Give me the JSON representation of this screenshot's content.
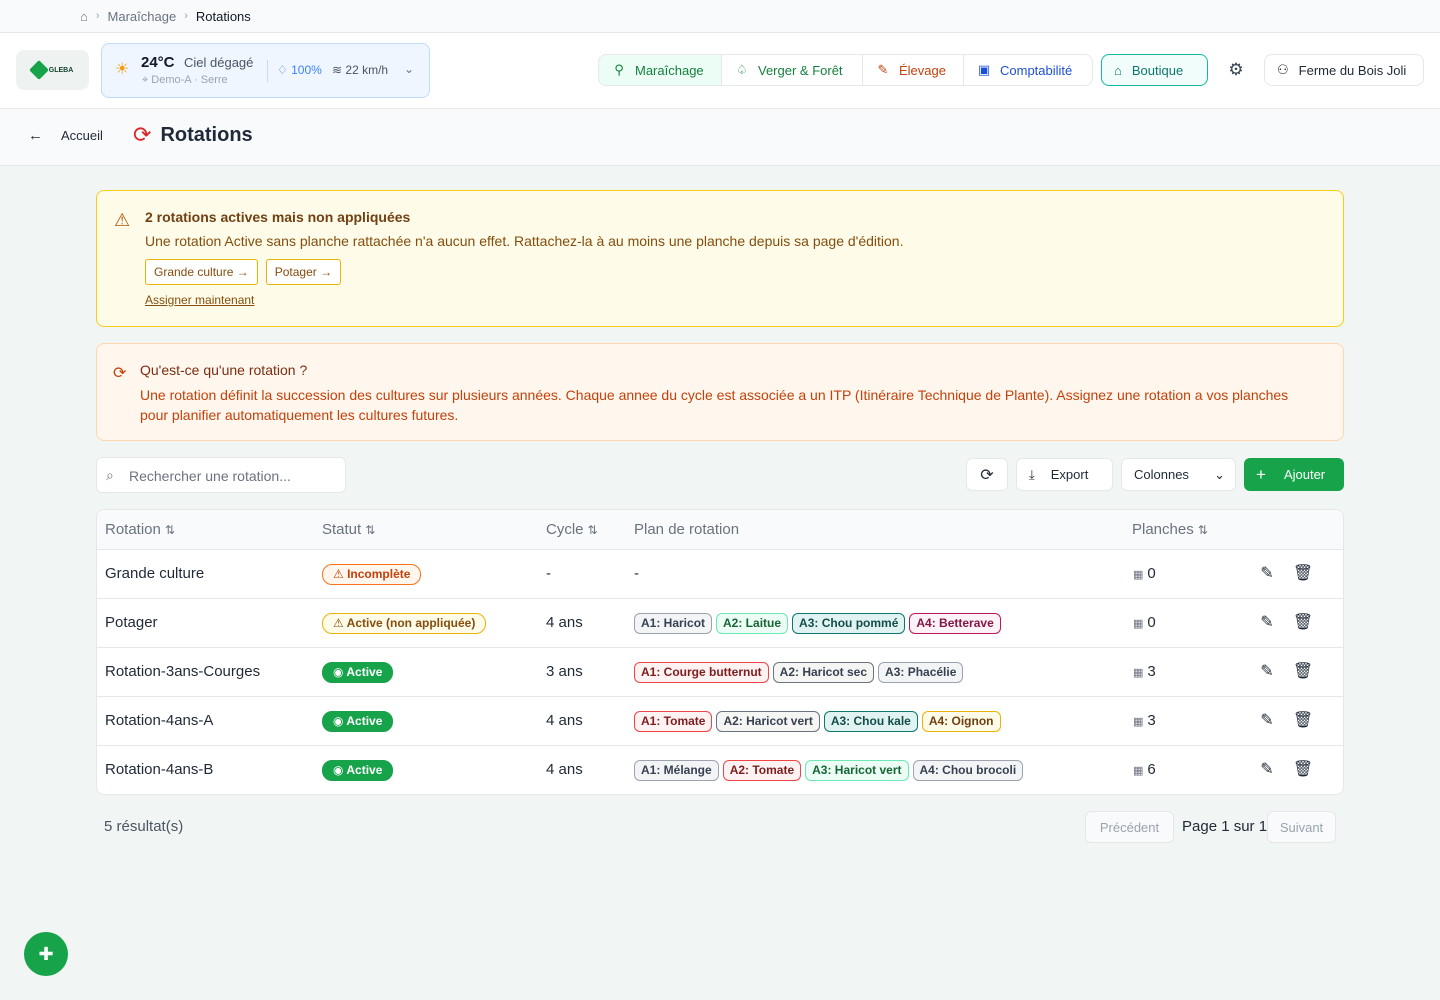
{
  "breadcrumb": {
    "items": [
      "Maraîchage",
      "Rotations"
    ]
  },
  "header": {
    "logo_text": "GLEBA",
    "weather": {
      "temperature": "24°C",
      "condition": "Ciel dégagé",
      "location": "Demo-A · Serre",
      "humidity": "100%",
      "wind": "22 km/h"
    },
    "modules": [
      {
        "label": "Maraîchage",
        "icon": "sprout-icon"
      },
      {
        "label": "Verger & Forêt",
        "icon": "tree-icon"
      },
      {
        "label": "Élevage",
        "icon": "carrot-icon"
      },
      {
        "label": "Comptabilité",
        "icon": "wallet-icon"
      }
    ],
    "shop_label": "Boutique",
    "farm_name": "Ferme du Bois Joli"
  },
  "page": {
    "back_label": "Accueil",
    "title": "Rotations"
  },
  "warning": {
    "title": "2 rotations actives mais non appliquées",
    "text": "Une rotation Active sans planche rattachée n'a aucun effet. Rattachez-la à au moins une planche depuis sa page d'édition.",
    "chips": [
      "Grande culture →",
      "Potager →"
    ],
    "link": "Assigner maintenant"
  },
  "info": {
    "title": "Qu'est-ce qu'une rotation ?",
    "text": "Une rotation définit la succession des cultures sur plusieurs années. Chaque annee du cycle est associée a un ITP (Itinéraire Technique de Plante). Assignez une rotation a vos planches pour planifier automatiquement les cultures futures."
  },
  "toolbar": {
    "search_placeholder": "Rechercher une rotation...",
    "export_label": "Export",
    "columns_label": "Colonnes",
    "add_label": "Ajouter"
  },
  "table": {
    "headers": {
      "rotation": "Rotation",
      "status": "Statut",
      "cycle": "Cycle",
      "plan": "Plan de rotation",
      "planches": "Planches"
    },
    "rows": [
      {
        "name": "Grande culture",
        "status": "Incomplète",
        "status_type": "incomplete",
        "cycle": "-",
        "plan_empty": "-",
        "plan": [],
        "planches": "0"
      },
      {
        "name": "Potager",
        "status": "Active (non appliquée)",
        "status_type": "nonapplied",
        "cycle": "4 ans",
        "plan": [
          {
            "label": "A1: Haricot",
            "tone": "gray"
          },
          {
            "label": "A2: Laitue",
            "tone": "green"
          },
          {
            "label": "A3: Chou pommé",
            "tone": "teal"
          },
          {
            "label": "A4: Betterave",
            "tone": "pink"
          }
        ],
        "planches": "0"
      },
      {
        "name": "Rotation-3ans-Courges",
        "status": "Active",
        "status_type": "active",
        "cycle": "3 ans",
        "plan": [
          {
            "label": "A1: Courge butternut",
            "tone": "red"
          },
          {
            "label": "A2: Haricot sec",
            "tone": "olive"
          },
          {
            "label": "A3: Phacélie",
            "tone": "gray"
          }
        ],
        "planches": "3"
      },
      {
        "name": "Rotation-4ans-A",
        "status": "Active",
        "status_type": "active",
        "cycle": "4 ans",
        "plan": [
          {
            "label": "A1: Tomate",
            "tone": "red"
          },
          {
            "label": "A2: Haricot vert",
            "tone": "olive"
          },
          {
            "label": "A3: Chou kale",
            "tone": "teal"
          },
          {
            "label": "A4: Oignon",
            "tone": "yellow"
          }
        ],
        "planches": "3"
      },
      {
        "name": "Rotation-4ans-B",
        "status": "Active",
        "status_type": "active",
        "cycle": "4 ans",
        "plan": [
          {
            "label": "A1: Mélange",
            "tone": "gray"
          },
          {
            "label": "A2: Tomate",
            "tone": "red"
          },
          {
            "label": "A3: Haricot vert",
            "tone": "green"
          },
          {
            "label": "A4: Chou brocoli",
            "tone": "gray"
          }
        ],
        "planches": "6"
      }
    ]
  },
  "footer": {
    "results": "5 résultat(s)",
    "prev_label": "Précédent",
    "page_info": "Page 1 sur 1",
    "next_label": "Suivant"
  }
}
